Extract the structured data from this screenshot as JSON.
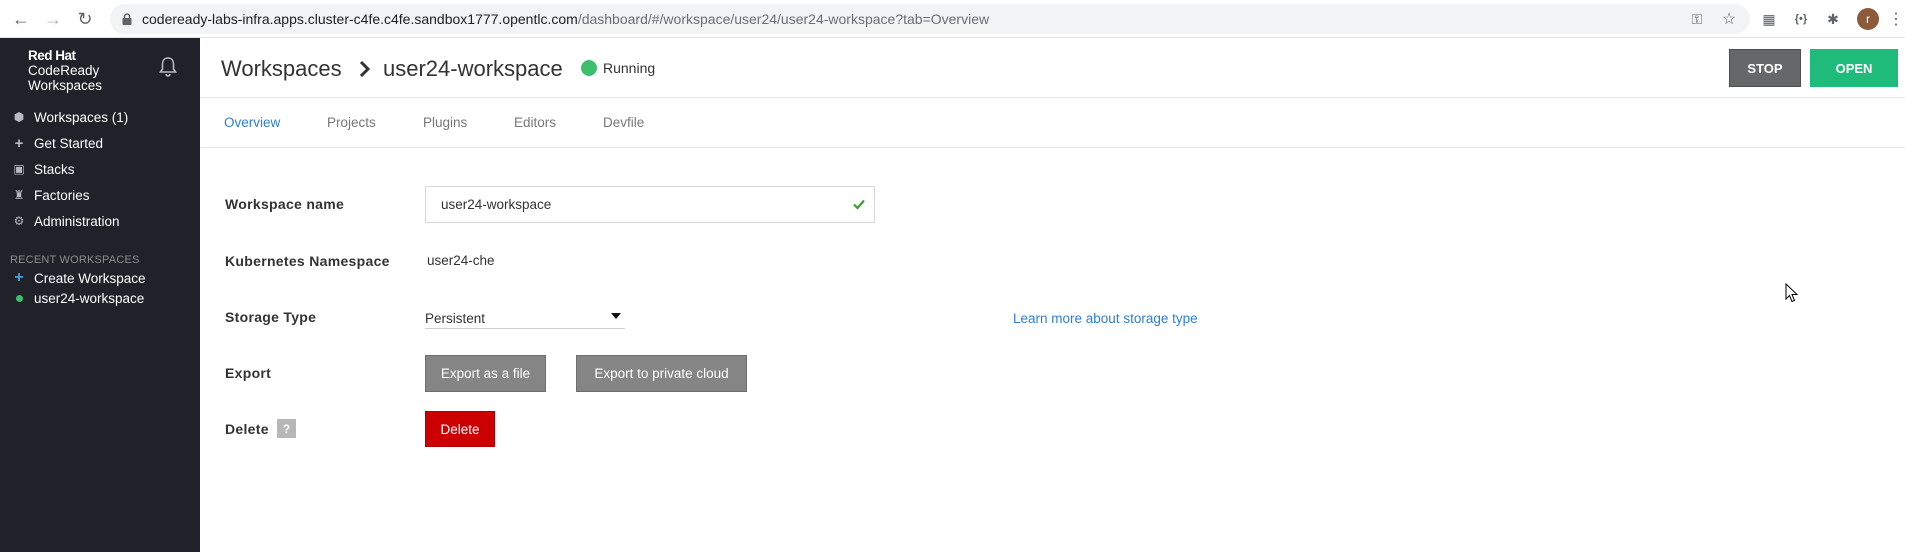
{
  "browser": {
    "url_main": "codeready-labs-infra.apps.cluster-c4fe.c4fe.sandbox1777.opentlc.com",
    "url_rest": "/dashboard/#/workspace/user24/user24-workspace?tab=Overview",
    "avatar_letter": "r"
  },
  "sidebar": {
    "brand_line1": "Red Hat",
    "brand_line2": "CodeReady",
    "brand_line3": "Workspaces",
    "items": [
      {
        "label": "Workspaces (1)",
        "icon": "cube-icon"
      },
      {
        "label": "Get Started",
        "icon": "plus-icon"
      },
      {
        "label": "Stacks",
        "icon": "stack-icon"
      },
      {
        "label": "Factories",
        "icon": "factory-icon"
      },
      {
        "label": "Administration",
        "icon": "gear-icon"
      }
    ],
    "recent_title": "RECENT WORKSPACES",
    "recent": [
      {
        "label": "Create Workspace"
      },
      {
        "label": "user24-workspace"
      }
    ]
  },
  "header": {
    "title": "Workspaces",
    "workspace_name": "user24-workspace",
    "status": "Running",
    "stop_label": "STOP",
    "open_label": "OPEN"
  },
  "tabs": [
    {
      "label": "Overview"
    },
    {
      "label": "Projects"
    },
    {
      "label": "Plugins"
    },
    {
      "label": "Editors"
    },
    {
      "label": "Devfile"
    }
  ],
  "form": {
    "workspace_name_label": "Workspace name",
    "workspace_name_value": "user24-workspace",
    "namespace_label": "Kubernetes Namespace",
    "namespace_value": "user24-che",
    "storage_label": "Storage Type",
    "storage_value": "Persistent",
    "storage_link": "Learn more about storage type",
    "export_label": "Export",
    "export_file": "Export as a file",
    "export_cloud": "Export to private cloud",
    "delete_label": "Delete",
    "delete_help": "?",
    "delete_button": "Delete"
  },
  "colors": {
    "sidebar_bg": "#202129",
    "accent_blue": "#2e7ed1",
    "running_green": "#3dbf6e",
    "open_green": "#1fbb7a",
    "delete_red": "#cc0000"
  }
}
